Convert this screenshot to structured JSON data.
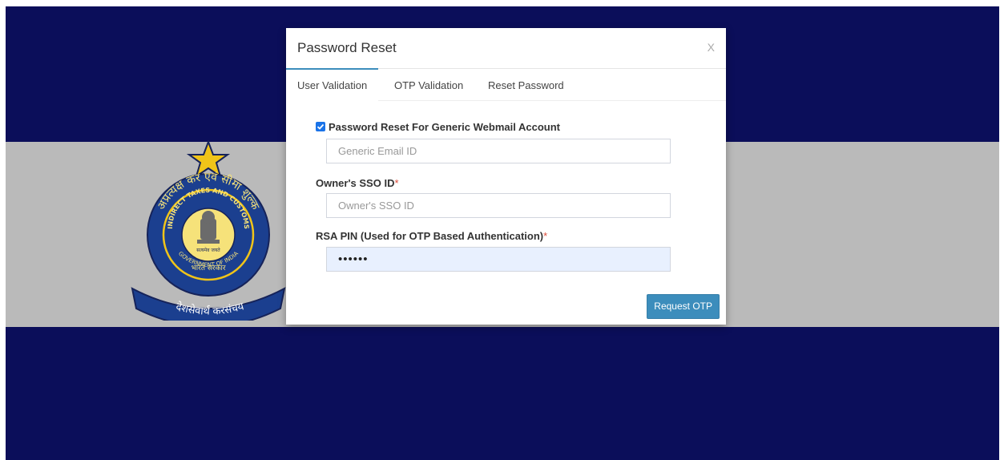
{
  "modal": {
    "title": "Password Reset",
    "close_label": "X"
  },
  "tabs": [
    {
      "label": "User Validation",
      "active": true
    },
    {
      "label": "OTP Validation",
      "active": false
    },
    {
      "label": "Reset Password",
      "active": false
    }
  ],
  "form": {
    "generic_checkbox": {
      "label": "Password Reset For Generic Webmail Account",
      "checked": true
    },
    "generic_email": {
      "placeholder": "Generic Email ID",
      "value": ""
    },
    "owner_sso": {
      "label": "Owner's SSO ID",
      "required_mark": "*",
      "placeholder": "Owner's SSO ID",
      "value": ""
    },
    "rsa_pin": {
      "label": "RSA PIN (Used for OTP Based Authentication)",
      "required_mark": "*",
      "value": "••••••"
    },
    "submit_label": "Request OTP"
  },
  "emblem": {
    "text_top": "अप्रत्यक्ष कर एवं सीमा शुल्क",
    "text_ring": "INDIRECT TAXES AND CUSTOMS",
    "text_gov": "GOVERNMENT OF INDIA",
    "text_motto": "सत्यमेव जयते",
    "text_bharat": "भारत सरकार",
    "text_banner": "देशसेवार्थ करसंचय"
  },
  "colors": {
    "dark_blue": "#0b0e5a",
    "gray_band": "#bababa",
    "accent": "#3c8dbc",
    "required": "#dd4b39"
  }
}
